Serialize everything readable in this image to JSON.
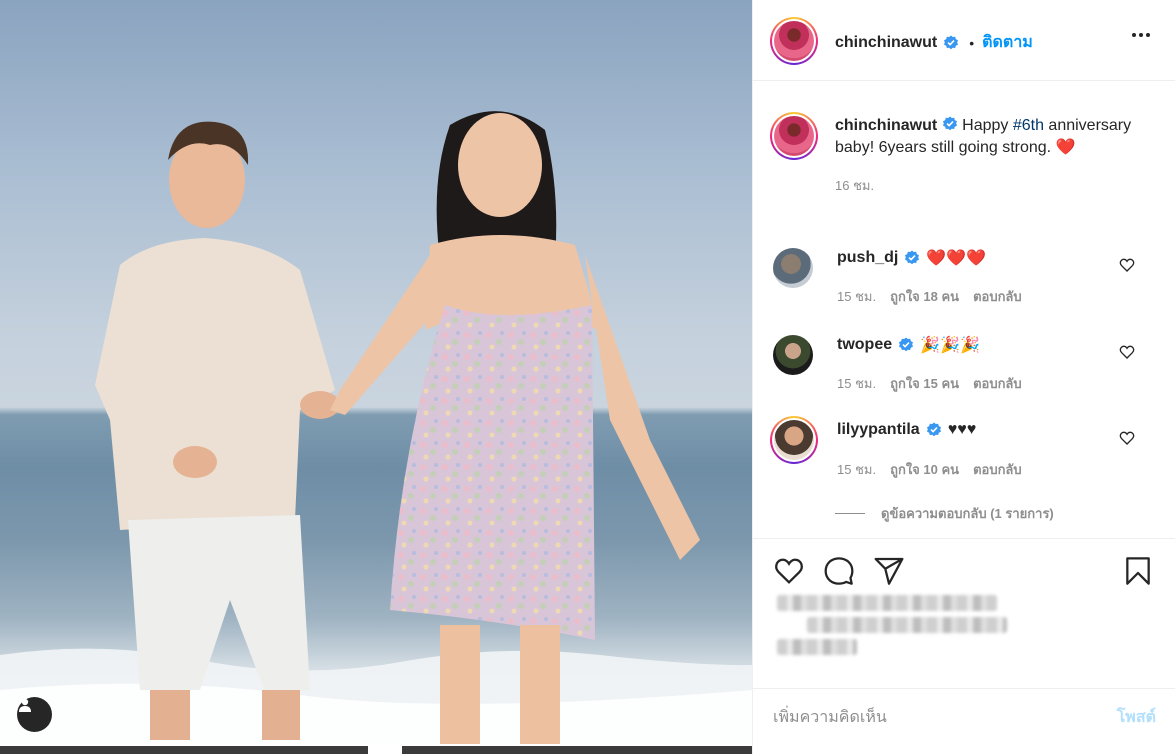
{
  "post": {
    "author": "chinchinawut",
    "follow_label": "ติดตาม",
    "separator": "•",
    "caption_prefix": "Happy ",
    "caption_hashtag": "#6th",
    "caption_rest": " anniversary baby! 6years still going strong.",
    "caption_emoji": "❤️",
    "time": "16 ชม."
  },
  "comments": [
    {
      "username": "push_dj",
      "text": "❤️❤️❤️",
      "time": "15 ชม.",
      "likes": "ถูกใจ 18 คน",
      "reply": "ตอบกลับ"
    },
    {
      "username": "twopee",
      "text": "🎉🎉🎉",
      "time": "15 ชม.",
      "likes": "ถูกใจ 15 คน",
      "reply": "ตอบกลับ"
    },
    {
      "username": "lilyypantila",
      "text": "♥♥♥",
      "time": "15 ชม.",
      "likes": "ถูกใจ 10 คน",
      "reply": "ตอบกลับ"
    }
  ],
  "view_replies": "ดูข้อความตอบกลับ (1 รายการ)",
  "add_comment": {
    "placeholder": "เพิ่มความคิดเห็น",
    "post_label": "โพสต์"
  },
  "colors": {
    "link_blue": "#0095f6",
    "verified_blue": "#3897f0",
    "heart_red": "#ed4956",
    "muted": "#8e8e8e"
  }
}
